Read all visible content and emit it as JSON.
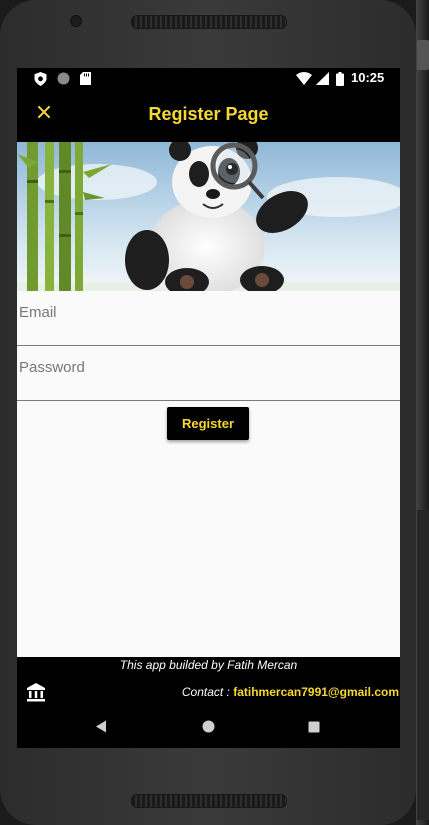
{
  "status_bar": {
    "time": "10:25",
    "left_icons": [
      "shield-icon",
      "circle-icon",
      "sd-card-icon"
    ],
    "right_icons": [
      "wifi-icon",
      "signal-icon",
      "battery-icon"
    ]
  },
  "app_bar": {
    "title": "Register Page",
    "close_icon": "close-icon"
  },
  "form": {
    "email_placeholder": "Email",
    "password_placeholder": "Password",
    "email_value": "",
    "password_value": "",
    "register_label": "Register"
  },
  "footer": {
    "credit": "This app builded by Fatih Mercan",
    "contact_label": "Contact : ",
    "contact_email": "fatihmercan7991@gmail.com",
    "bank_icon": "bank-icon"
  },
  "nav_bar": {
    "icons": [
      "back-icon",
      "home-icon",
      "recents-icon"
    ]
  },
  "colors": {
    "accent": "#f5d832",
    "bar_background": "#000000",
    "screen_background": "#fafafa"
  }
}
